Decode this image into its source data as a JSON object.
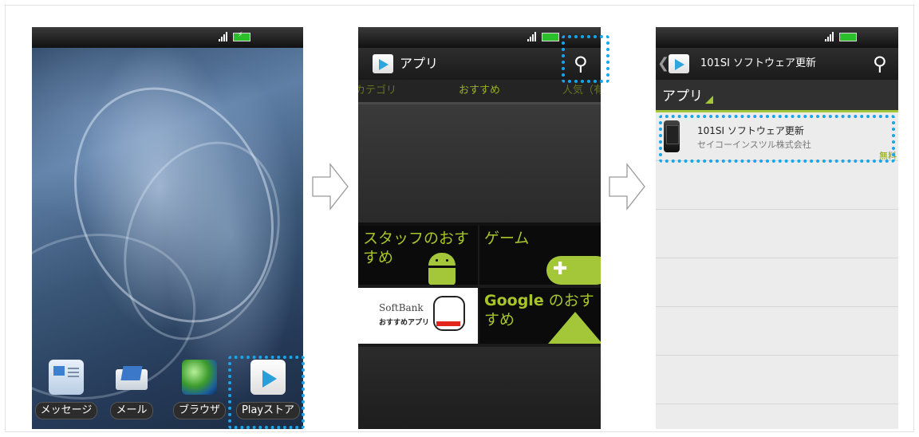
{
  "screen1": {
    "dock": [
      {
        "label": "メッセージ",
        "icon": "message-icon"
      },
      {
        "label": "メール",
        "icon": "mail-icon"
      },
      {
        "label": "ブラウザ",
        "icon": "browser-globe-icon"
      },
      {
        "label": "Playストア",
        "icon": "play-store-icon"
      }
    ]
  },
  "screen2": {
    "title": "アプリ",
    "tabs": [
      "カテゴリ",
      "おすすめ",
      "人気（有"
    ],
    "tiles": {
      "staff": "スタッフのおすすめ",
      "game": "ゲーム",
      "softbank_logo": "SoftBank",
      "softbank_sub": "おすすめアプリ",
      "google_bold": "Google",
      "google_rest": " のおすすめ"
    }
  },
  "screen3": {
    "title": "101SI ソフトウェア更新",
    "section": "アプリ",
    "app": {
      "name": "101SI ソフトウェア更新",
      "developer": "セイコーインスツル株式会社",
      "price": "無料"
    }
  },
  "colors": {
    "highlight": "#1aa5e8",
    "accent": "#a4c639"
  }
}
